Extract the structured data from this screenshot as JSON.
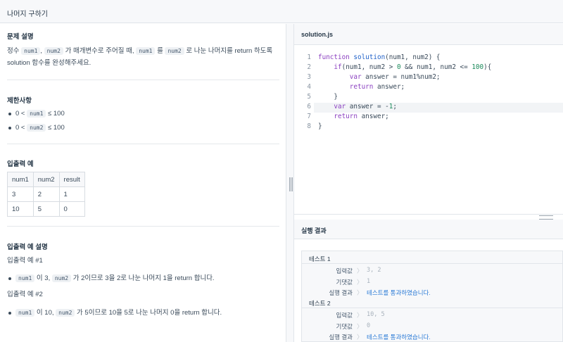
{
  "header": {
    "title": "나머지 구하기"
  },
  "problem": {
    "desc_heading": "문제 설명",
    "desc_text_1": "정수",
    "desc_code_1": "num1",
    "desc_comma": ",",
    "desc_code_2": "num2",
    "desc_text_2": "가 매개변수로 주어질 때,",
    "desc_code_3": "num1",
    "desc_text_3": "를",
    "desc_code_4": "num2",
    "desc_text_4": "로 나눈 나머지를 return 하도록",
    "desc_text_5": "solution 함수를 완성해주세요.",
    "constraints_heading": "제한사항",
    "constraints": [
      {
        "pre": "0 <",
        "code": "num1",
        "post": "≤ 100"
      },
      {
        "pre": "0 <",
        "code": "num2",
        "post": "≤ 100"
      }
    ],
    "examples_heading": "입출력 예",
    "table": {
      "headers": [
        "num1",
        "num2",
        "result"
      ],
      "rows": [
        [
          "3",
          "2",
          "1"
        ],
        [
          "10",
          "5",
          "0"
        ]
      ]
    },
    "explain_heading": "입출력 예 설명",
    "ex1_title": "입출력 예 #1",
    "ex1": {
      "code1": "num1",
      "t1": "이 3,",
      "code2": "num2",
      "t2": "가 2이므로 3을 2로 나눈 나머지 1을 return 합니다."
    },
    "ex2_title": "입출력 예 #2",
    "ex2": {
      "code1": "num1",
      "t1": "이 10,",
      "code2": "num2",
      "t2": "가 5이므로 10을 5로 나눈 나머지 0을 return 합니다."
    }
  },
  "editor": {
    "filename": "solution.js",
    "lines": [
      "function solution(num1, num2) {",
      "    if(num1, num2 > 0 && num1, num2 <= 100){",
      "        var answer = num1%num2;",
      "        return answer;",
      "    }",
      "    var answer = -1;",
      "    return answer;",
      "}"
    ],
    "line_numbers": [
      "1",
      "2",
      "3",
      "4",
      "5",
      "6",
      "7",
      "8"
    ]
  },
  "results": {
    "heading": "실행 결과",
    "tests": [
      {
        "name": "테스트 1",
        "input_label": "입력값",
        "input": "3, 2",
        "expected_label": "기댓값",
        "expected": "1",
        "result_label": "실행 결과",
        "result": "테스트를 통과하였습니다."
      },
      {
        "name": "테스트 2",
        "input_label": "입력값",
        "input": "10, 5",
        "expected_label": "기댓값",
        "expected": "0",
        "result_label": "실행 결과",
        "result": "테스트를 통과하였습니다."
      }
    ],
    "arrow": "〉"
  },
  "colors": {
    "accent": "#2a7ad6",
    "keyword": "#8a3fc0",
    "function": "#2061c9"
  }
}
